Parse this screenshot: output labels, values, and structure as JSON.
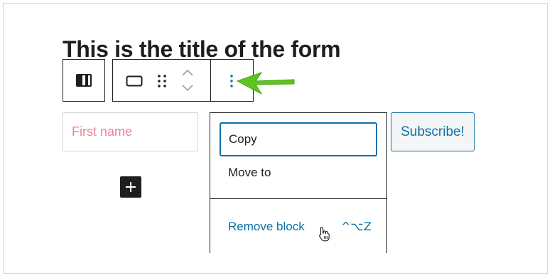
{
  "form": {
    "title": "This is the title of the form",
    "first_name_placeholder": "First name",
    "subscribe_label": "Subscribe!"
  },
  "toolbar": {
    "buttons": [
      {
        "name": "block-type",
        "icon": "block-split-icon"
      },
      {
        "name": "align",
        "icon": "align-wide-icon"
      },
      {
        "name": "drag",
        "icon": "drag-handle-icon"
      },
      {
        "name": "move-up",
        "icon": "chevron-up-icon"
      },
      {
        "name": "move-down",
        "icon": "chevron-down-icon"
      },
      {
        "name": "more-options",
        "icon": "more-vertical-icon"
      }
    ]
  },
  "menu": {
    "copy_label": "Copy",
    "move_to_label": "Move to",
    "remove_label": "Remove block",
    "remove_shortcut": "^⌥Z"
  },
  "colors": {
    "accent": "#0a6fa8",
    "placeholder": "#e8849a",
    "arrow": "#5ec51f",
    "text": "#1e1e1e"
  }
}
